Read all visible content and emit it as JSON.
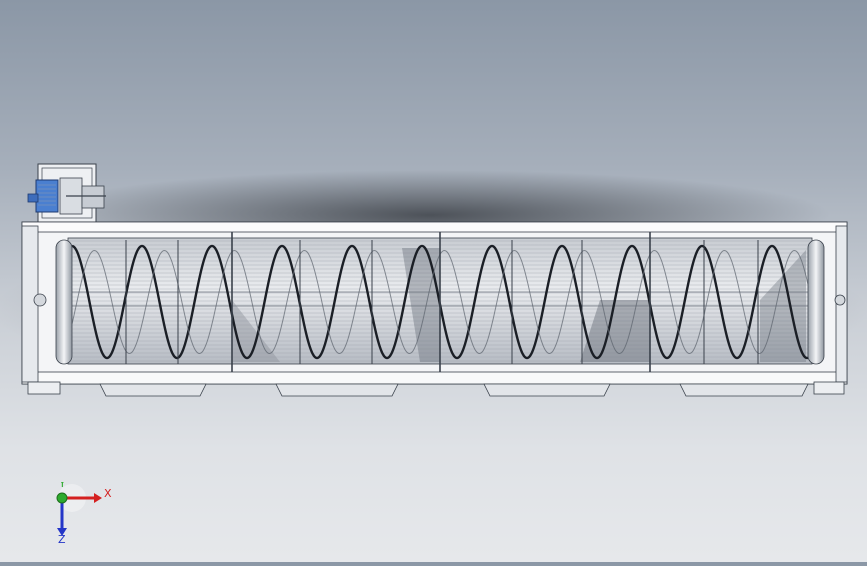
{
  "viewport": {
    "background_top": "#8b97a6",
    "background_bottom": "#e6e8eb",
    "model": {
      "frame_color": "#ffffff",
      "line_color": "#333a44",
      "screw_color": "#1b1f26",
      "motor_color": "#4a7fd0",
      "shadow_color": "#2e3238",
      "screw_sections": 4
    }
  },
  "triad": {
    "x_label": "X",
    "y_label": "Y",
    "z_label": "Z",
    "x_color": "#d42020",
    "y_color": "#2eaa2e",
    "z_color": "#2436c8"
  }
}
